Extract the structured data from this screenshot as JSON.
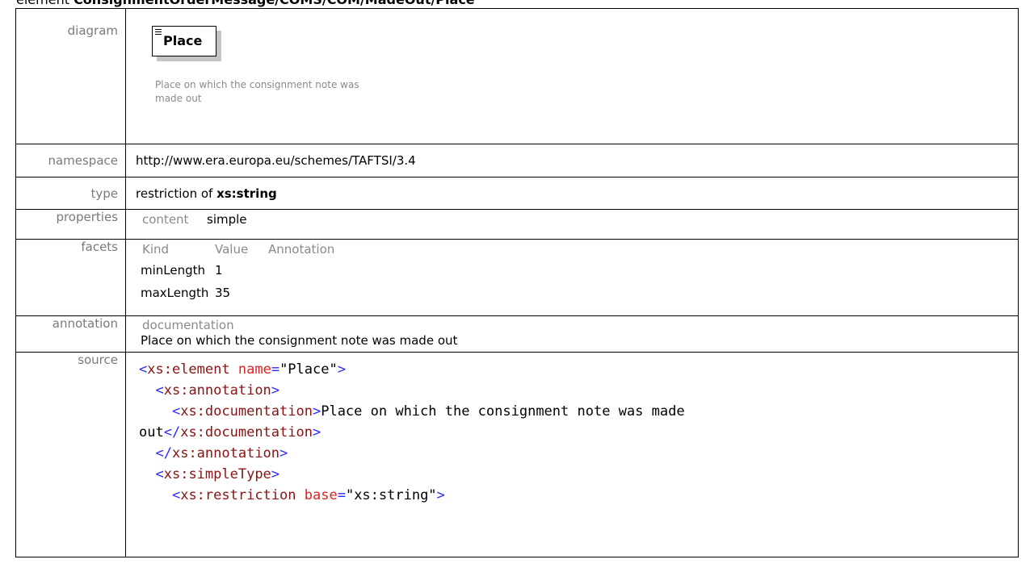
{
  "header": {
    "prefix": "element ",
    "path": "ConsignmentOrderMessage/COMS/COM/MadeOut/Place"
  },
  "labels": {
    "diagram": "diagram",
    "namespace": "namespace",
    "type": "type",
    "properties": "properties",
    "facets": "facets",
    "annotation": "annotation",
    "source": "source"
  },
  "diagram": {
    "element_name": "Place",
    "documentation": "Place on which the consignment note was made out"
  },
  "namespace": "http://www.era.europa.eu/schemes/TAFTSI/3.4",
  "type": {
    "prefix": "restriction of ",
    "base": "xs:string"
  },
  "properties": {
    "key": "content",
    "value": "simple"
  },
  "facets": {
    "headers": [
      "Kind",
      "Value",
      "Annotation"
    ],
    "rows": [
      {
        "kind": "minLength",
        "value": "1"
      },
      {
        "kind": "maxLength",
        "value": "35"
      }
    ]
  },
  "annotation": {
    "heading": "documentation",
    "text": "Place on which the consignment note was made out"
  },
  "source": {
    "lines": [
      "<xs:element name=\"Place\">",
      "  <xs:annotation>",
      "    <xs:documentation>Place on which the consignment note was made",
      "out</xs:documentation>",
      "  </xs:annotation>",
      "  <xs:simpleType>",
      "    <xs:restriction base=\"xs:string\">"
    ]
  },
  "colors": {
    "tag": "#2a2aff",
    "tag_name": "#8a1212",
    "attr_name": "#e02020",
    "label_gray": "#7a7a7a"
  }
}
